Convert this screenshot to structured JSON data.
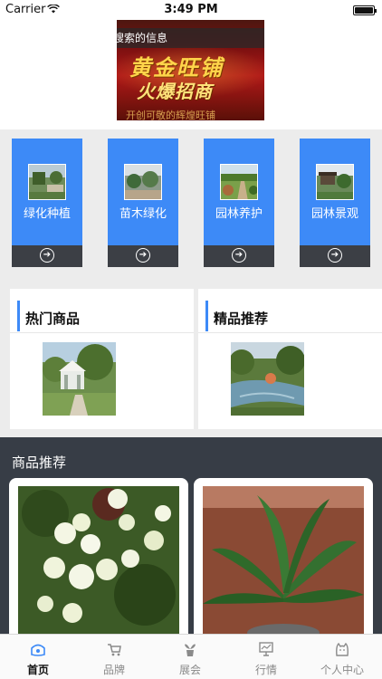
{
  "status_bar": {
    "carrier": "Carrier",
    "time": "3:49 PM"
  },
  "search": {
    "placeholder": "搜索的信息"
  },
  "banner": {
    "line1": "黄金旺铺",
    "line2": "火爆招商",
    "line3": "开创可敬的辉煌旺铺"
  },
  "categories": [
    {
      "label": "绿化种植",
      "icon": "arrow-circle-icon"
    },
    {
      "label": "苗木绿化",
      "icon": "arrow-circle-icon"
    },
    {
      "label": "园林养护",
      "icon": "arrow-circle-icon"
    },
    {
      "label": "园林景观",
      "icon": "arrow-circle-icon"
    }
  ],
  "featured": [
    {
      "heading": "热门商品"
    },
    {
      "heading": "精品推荐"
    }
  ],
  "recommend": {
    "title": "商品推荐"
  },
  "tabbar": [
    {
      "label": "首页",
      "icon": "home-icon",
      "active": true
    },
    {
      "label": "品牌",
      "icon": "shop-cart-icon",
      "active": false
    },
    {
      "label": "展会",
      "icon": "plant-pot-icon",
      "active": false
    },
    {
      "label": "行情",
      "icon": "monitor-chart-icon",
      "active": false
    },
    {
      "label": "个人中心",
      "icon": "profile-face-icon",
      "active": false
    }
  ],
  "colors": {
    "accent": "#3d8af7",
    "dark": "#373d46",
    "tab_active": "#111111",
    "tab_inactive": "#8a8a8a"
  }
}
